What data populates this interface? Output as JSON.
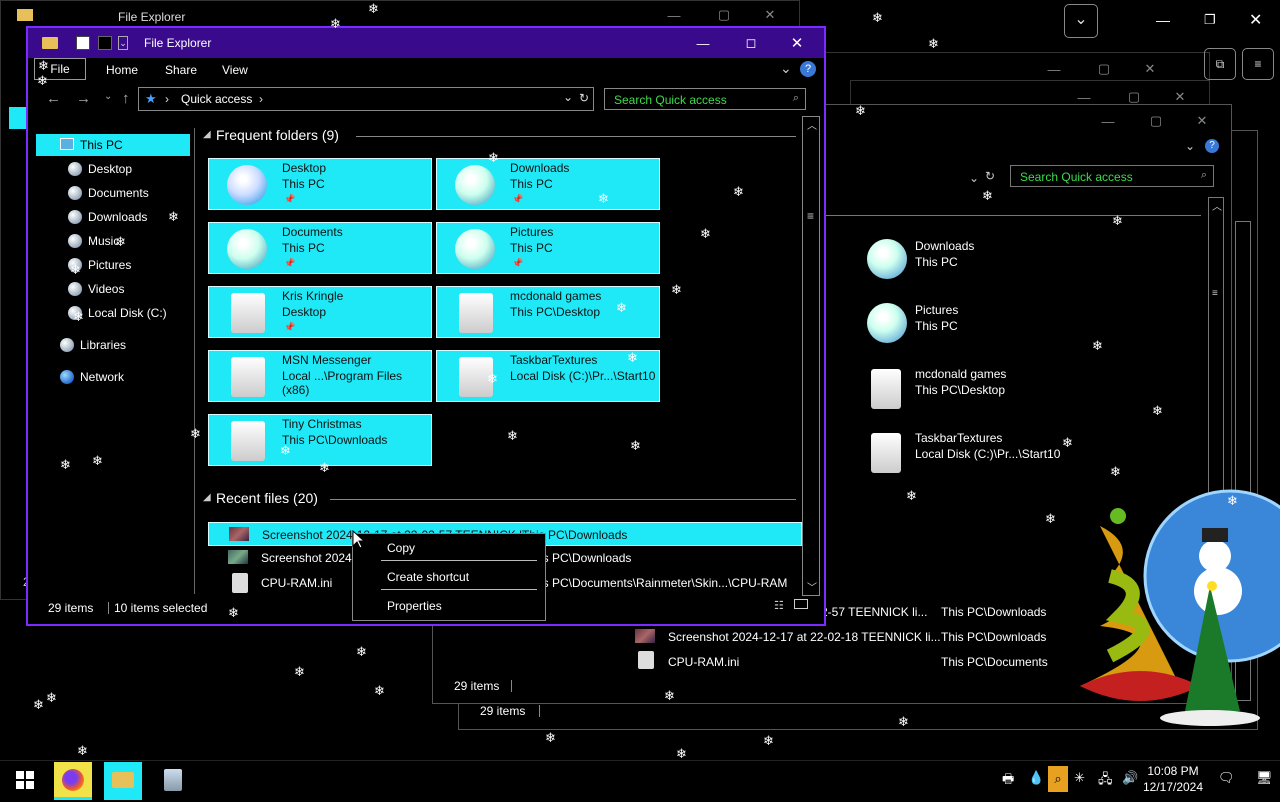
{
  "colors": {
    "accent": "#1fe9f7",
    "titlebar": "#3a0a8c",
    "search_text": "#3bdc4a",
    "window_border": "#7a2bff"
  },
  "main_window": {
    "title": "File Explorer",
    "ribbon_tabs": [
      "File",
      "Home",
      "Share",
      "View"
    ],
    "address": "Quick access",
    "search_placeholder": "Search Quick access",
    "nav": {
      "this_pc": "This PC",
      "items": [
        "Desktop",
        "Documents",
        "Downloads",
        "Music",
        "Pictures",
        "Videos",
        "Local Disk (C:)"
      ],
      "libraries": "Libraries",
      "network": "Network"
    },
    "frequent_header": "Frequent folders (9)",
    "folders": [
      {
        "name": "Desktop",
        "path": "This PC",
        "icon": "desktop-folder-icon"
      },
      {
        "name": "Downloads",
        "path": "This PC",
        "icon": "downloads-folder-icon"
      },
      {
        "name": "Documents",
        "path": "This PC",
        "icon": "documents-folder-icon"
      },
      {
        "name": "Pictures",
        "path": "This PC",
        "icon": "pictures-folder-icon"
      },
      {
        "name": "Kris Kringle",
        "path": "Desktop",
        "icon": "folder-icon"
      },
      {
        "name": "mcdonald games",
        "path": "This PC\\Desktop",
        "icon": "folder-icon"
      },
      {
        "name": "MSN Messenger",
        "path": "Local ...\\Program Files (x86)",
        "icon": "folder-icon"
      },
      {
        "name": "TaskbarTextures",
        "path": "Local Disk (C:)\\Pr...\\Start10",
        "icon": "folder-icon"
      },
      {
        "name": "Tiny Christmas",
        "path": "This PC\\Downloads",
        "icon": "folder-icon"
      }
    ],
    "recent_header": "Recent files (20)",
    "recent_files": [
      {
        "name": "Screenshot 2024-12-17 at 22-02-57 TEENNICK li...",
        "path": "This PC\\Downloads"
      },
      {
        "name": "Screenshot 2024-",
        "path": "is PC\\Downloads"
      },
      {
        "name": "CPU-RAM.ini",
        "path": "is PC\\Documents\\Rainmeter\\Skin...\\CPU-RAM"
      }
    ],
    "status_items": "29 items",
    "status_selected": "10 items selected"
  },
  "context_menu": {
    "items": [
      "Copy",
      "Create shortcut",
      "Properties"
    ]
  },
  "bg_window_1": {
    "title": "File Explorer"
  },
  "bg_window_3": {
    "search_placeholder": "Search Quick access",
    "folders": [
      {
        "name": "Downloads",
        "path": "This PC"
      },
      {
        "name": "Pictures",
        "path": "This PC"
      },
      {
        "name": "mcdonald games",
        "path": "This PC\\Desktop"
      },
      {
        "name": "TaskbarTextures",
        "path": "Local Disk (C:)\\Pr...\\Start10"
      }
    ],
    "status_items": "29 items",
    "recent": [
      {
        "name": "2-57 TEENNICK li...",
        "path": "This PC\\Downloads"
      },
      {
        "name": "Screenshot 2024-12-17 at 22-02-18 TEENNICK li...",
        "path": "This PC\\Downloads"
      },
      {
        "name": "CPU-RAM.ini",
        "path": "This PC\\Documents"
      }
    ]
  },
  "bg_window_4": {
    "status_items": "29 items"
  },
  "taskbar": {
    "time": "10:08 PM",
    "date": "12/17/2024"
  }
}
